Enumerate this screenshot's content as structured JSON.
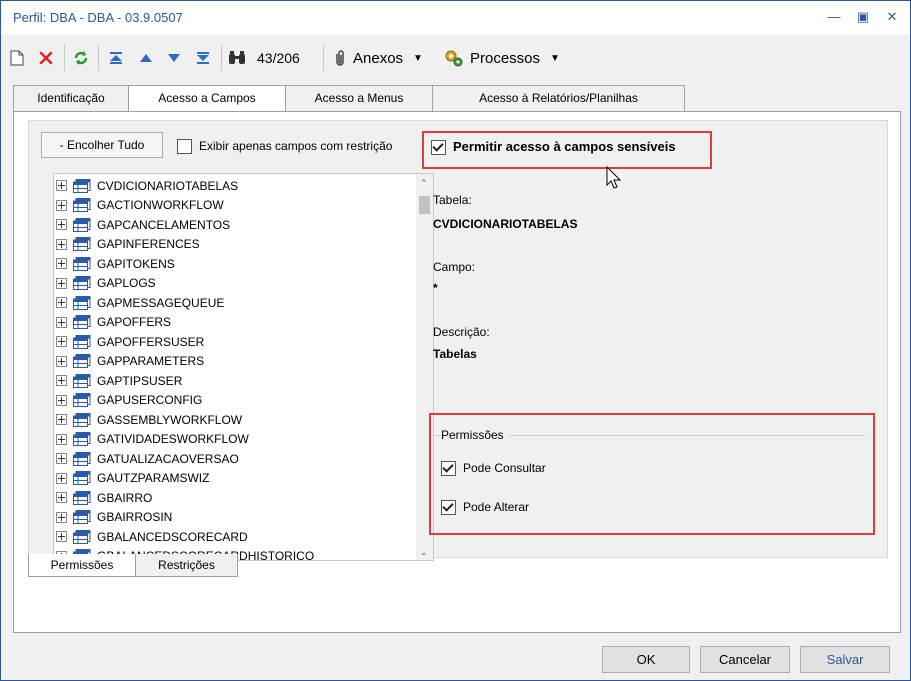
{
  "window": {
    "title": "Perfil: DBA - DBA - 03.9.0507"
  },
  "toolbar": {
    "record_counter": "43/206",
    "anexos_label": "Anexos",
    "processos_label": "Processos"
  },
  "tabs": [
    {
      "label": "Identificação",
      "active": false
    },
    {
      "label": "Acesso a Campos",
      "active": true
    },
    {
      "label": "Acesso a Menus",
      "active": false
    },
    {
      "label": "Acesso à Relatórios/Planilhas",
      "active": false
    }
  ],
  "campos": {
    "collapse_button": "- Encolher Tudo",
    "only_restricted_label": "Exibir apenas campos com restrição",
    "only_restricted_checked": false,
    "allow_sensitive_label": "Permitir acesso à campos sensíveis",
    "allow_sensitive_checked": true
  },
  "tree_items": [
    "CVDICIONARIOTABELAS",
    "GACTIONWORKFLOW",
    "GAPCANCELAMENTOS",
    "GAPINFERENCES",
    "GAPITOKENS",
    "GAPLOGS",
    "GAPMESSAGEQUEUE",
    "GAPOFFERS",
    "GAPOFFERSUSER",
    "GAPPARAMETERS",
    "GAPTIPSUSER",
    "GAPUSERCONFIG",
    "GASSEMBLYWORKFLOW",
    "GATIVIDADESWORKFLOW",
    "GATUALIZACAOVERSAO",
    "GAUTZPARAMSWIZ",
    "GBAIRRO",
    "GBAIRROSIN",
    "GBALANCEDSCORECARD",
    "GBALANCEDSCORECARDHISTORICO"
  ],
  "details": {
    "tabela_label": "Tabela:",
    "tabela_value": "CVDICIONARIOTABELAS",
    "campo_label": "Campo:",
    "campo_value": "*",
    "descricao_label": "Descrição:",
    "descricao_value": "Tabelas"
  },
  "permissoes": {
    "group_label": "Permissões",
    "consultar_label": "Pode Consultar",
    "consultar_checked": true,
    "alterar_label": "Pode Alterar",
    "alterar_checked": true
  },
  "bottom_tabs": [
    {
      "label": "Permissões",
      "active": true
    },
    {
      "label": "Restrições",
      "active": false
    }
  ],
  "footer": {
    "ok_label": "OK",
    "cancel_label": "Cancelar",
    "save_label": "Salvar"
  },
  "colors": {
    "title_blue": "#2b5797",
    "highlight_red": "#e03c3c",
    "table_icon_blue": "#2a5aa8"
  }
}
